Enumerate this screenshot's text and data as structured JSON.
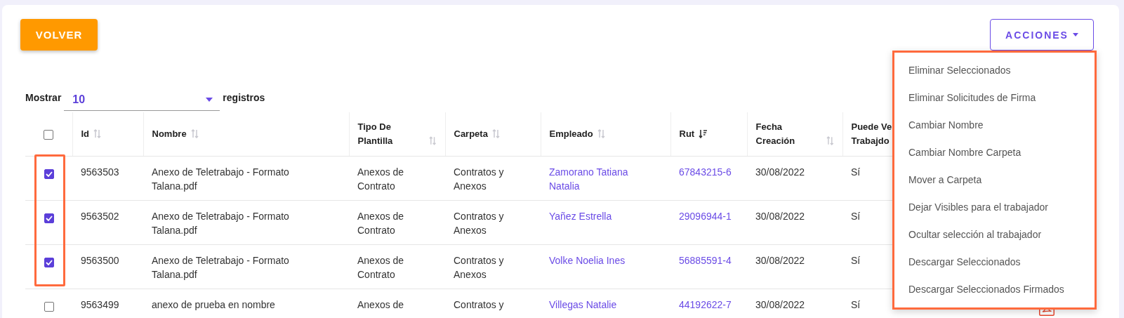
{
  "back_button": {
    "label": "VOLVER"
  },
  "actions_button": {
    "label": "ACCIONES"
  },
  "actions_menu": {
    "highlighted": true,
    "items": [
      {
        "label": "Eliminar Seleccionados"
      },
      {
        "label": "Eliminar Solicitudes de Firma"
      },
      {
        "label": "Cambiar Nombre"
      },
      {
        "label": "Cambiar Nombre Carpeta"
      },
      {
        "label": "Mover a Carpeta"
      },
      {
        "label": "Dejar Visibles para el trabajador"
      },
      {
        "label": "Ocultar selección al trabajador"
      },
      {
        "label": "Descargar Seleccionados"
      },
      {
        "label": "Descargar Seleccionados Firmados"
      }
    ]
  },
  "page_size": {
    "label_before": "Mostrar",
    "value": "10",
    "label_after": "registros"
  },
  "table": {
    "select_all_checked": false,
    "checkbox_column_highlighted": true,
    "columns": [
      {
        "label": "Id",
        "sorted": false
      },
      {
        "label": "Nombre",
        "sorted": false
      },
      {
        "label": "Tipo De Plantilla",
        "sorted": false
      },
      {
        "label": "Carpeta",
        "sorted": false
      },
      {
        "label": "Empleado",
        "sorted": false
      },
      {
        "label": "Rut",
        "sorted": true
      },
      {
        "label": "Fecha Creación",
        "sorted": false
      },
      {
        "label": "Puede Ve Trabajdo"
      }
    ],
    "rows": [
      {
        "checked": true,
        "id": "9563503",
        "name": "Anexo de Teletrabajo - Formato Talana.pdf",
        "template": "Anexos de Contrato",
        "folder": "Contratos y Anexos",
        "employee": "Zamorano Tatiana Natalia",
        "rut": "67843215-6",
        "date": "30/08/2022",
        "visible": "Sí",
        "pdf_icon": false
      },
      {
        "checked": true,
        "id": "9563502",
        "name": "Anexo de Teletrabajo - Formato Talana.pdf",
        "template": "Anexos de Contrato",
        "folder": "Contratos y Anexos",
        "employee": "Yañez Estrella",
        "rut": "29096944-1",
        "date": "30/08/2022",
        "visible": "Sí",
        "pdf_icon": false
      },
      {
        "checked": true,
        "id": "9563500",
        "name": "Anexo de Teletrabajo - Formato Talana.pdf",
        "template": "Anexos de Contrato",
        "folder": "Contratos y Anexos",
        "employee": "Volke Noelia Ines",
        "rut": "56885591-4",
        "date": "30/08/2022",
        "visible": "Sí",
        "pdf_icon": false
      },
      {
        "checked": false,
        "id": "9563499",
        "name": "anexo de prueba en nombre",
        "template": "Anexos de",
        "folder": "Contratos y",
        "employee": "Villegas Natalie",
        "rut": "44192622-7",
        "date": "30/08/2022",
        "visible": "Sí",
        "pdf_icon": true
      }
    ]
  }
}
